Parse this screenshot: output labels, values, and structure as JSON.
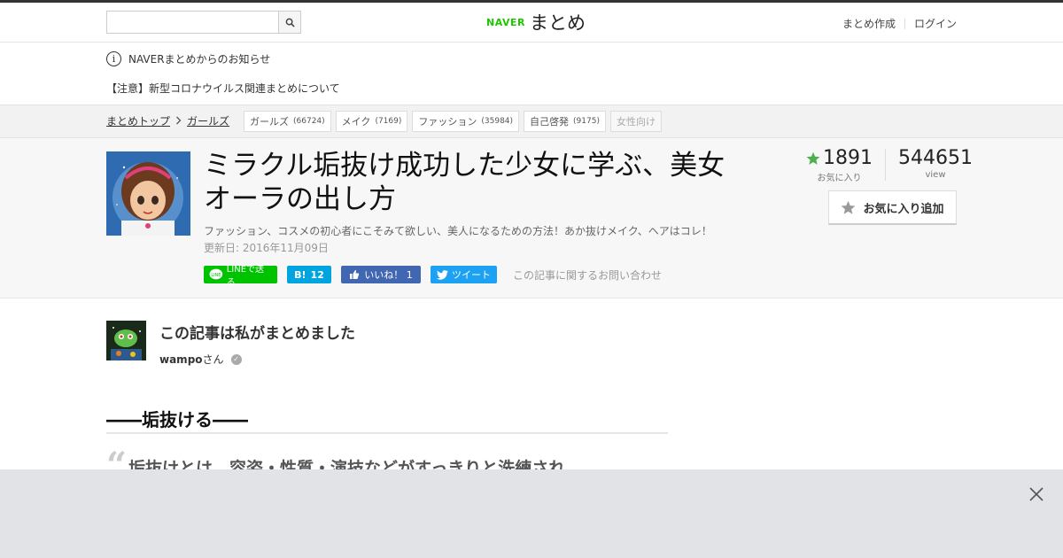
{
  "header": {
    "search": {
      "value": "",
      "placeholder": ""
    },
    "logo_naver": "NAVER",
    "logo_text": "まとめ",
    "links": {
      "create": "まとめ作成",
      "login": "ログイン"
    }
  },
  "notice": {
    "title": "NAVERまとめからのお知らせ",
    "item": "【注意】新型コロナウイルス関連まとめについて"
  },
  "breadcrumb": {
    "items": [
      "まとめトップ",
      "ガールズ"
    ]
  },
  "tags": [
    {
      "label": "ガールズ",
      "count": "(66724)"
    },
    {
      "label": "メイク",
      "count": "(7169)"
    },
    {
      "label": "ファッション",
      "count": "(35984)"
    },
    {
      "label": "自己啓発",
      "count": "(9175)"
    },
    {
      "label": "女性向け",
      "count": ""
    }
  ],
  "article": {
    "title": "ミラクル垢抜け成功した少女に学ぶ、美女オーラの出し方",
    "description": "ファッション、コスメの初心者にこそみて欲しい、美人になるための方法！あか抜けメイク、ヘアはコレ！",
    "updated": "更新日: 2016年11月09日",
    "share": {
      "line": "LINEで送る",
      "hatena": "12",
      "facebook": "いいね！ 1",
      "twitter": "ツイート",
      "contact": "この記事に関するお問い合わせ"
    },
    "stats": {
      "favorites": "1891",
      "favorites_label": "お気に入り",
      "views": "544651",
      "views_label": "view"
    },
    "fav_button": "お気に入り追加"
  },
  "author": {
    "heading": "この記事は私がまとめました",
    "name": "wampo",
    "suffix": "さん"
  },
  "content": {
    "section_title": "――垢抜ける――",
    "quote": "垢抜けとは、容姿・性質・演技などがすっきりと洗練され"
  },
  "colors": {
    "naver_green": "#1ec800",
    "star_green": "#4caf50",
    "line_green": "#00c300",
    "hatena_blue": "#00a4de",
    "facebook_blue": "#4267b2",
    "twitter_blue": "#1da1f2",
    "ad_background": "#e1e3e6"
  }
}
